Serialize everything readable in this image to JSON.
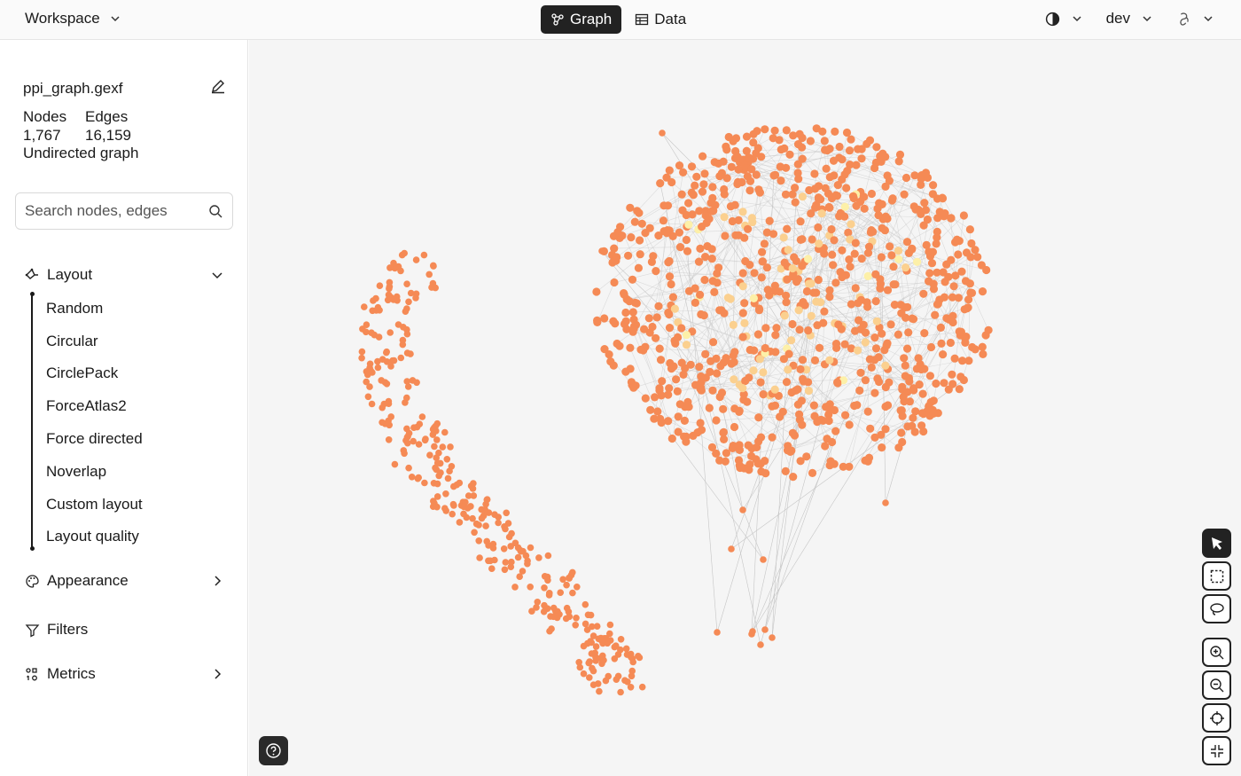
{
  "header": {
    "workspace_label": "Workspace",
    "tabs": [
      {
        "label": "Graph",
        "active": true
      },
      {
        "label": "Data",
        "active": false
      }
    ],
    "theme_icon": "contrast-icon",
    "branch_label": "dev",
    "account_icon": "github-icon"
  },
  "sidebar": {
    "file_name": "ppi_graph.gexf",
    "nodes_label": "Nodes",
    "edges_label": "Edges",
    "nodes_count": "1,767",
    "edges_count": "16,159",
    "graph_type": "Undirected graph",
    "search_placeholder": "Search nodes, edges",
    "sections": {
      "layout": {
        "label": "Layout",
        "items": [
          "Random",
          "Circular",
          "CirclePack",
          "ForceAtlas2",
          "Force directed",
          "Noverlap",
          "Custom layout",
          "Layout quality"
        ]
      },
      "appearance": {
        "label": "Appearance"
      },
      "filters": {
        "label": "Filters"
      },
      "metrics": {
        "label": "Metrics"
      }
    }
  },
  "canvas": {
    "colors": {
      "background": "#f5f5f5",
      "node": "#f58a55",
      "node_light": "#fbd08f",
      "node_pale": "#fdf0a8",
      "edge": "#c6c6c6"
    },
    "tools": [
      "pointer-tool",
      "marquee-select-tool",
      "lasso-select-tool",
      "zoom-in-tool",
      "zoom-out-tool",
      "center-view-tool",
      "fit-screen-tool"
    ]
  }
}
